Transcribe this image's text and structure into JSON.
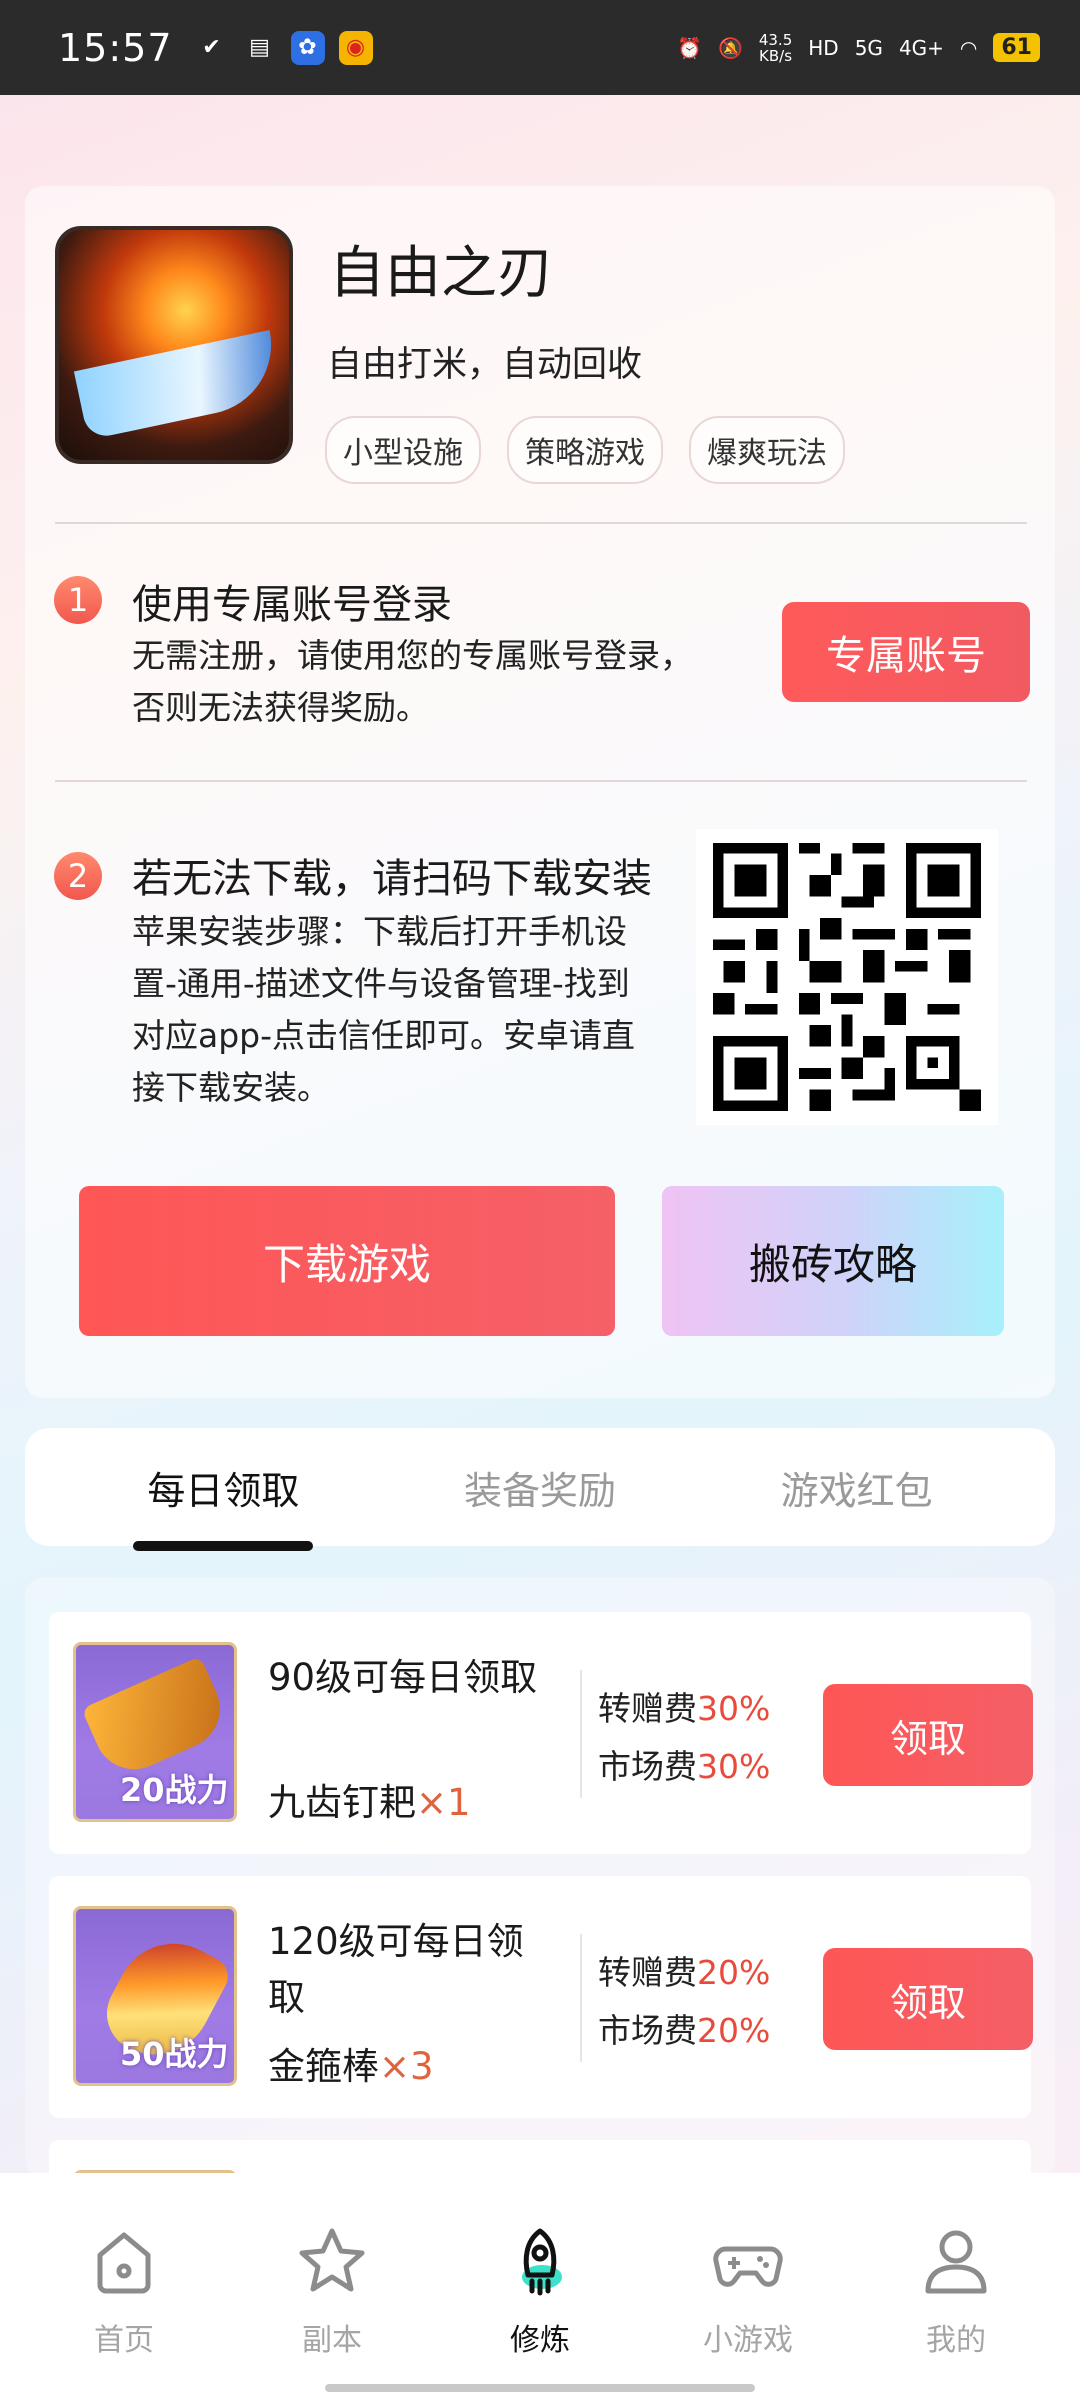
{
  "status_bar": {
    "time": "15:57",
    "speed": "43.5",
    "speed_unit": "KB/s",
    "network": "5G",
    "network2": "4G+",
    "battery": "61"
  },
  "game": {
    "title": "自由之刃",
    "subtitle": "自由打米，自动回收",
    "tags": [
      "小型设施",
      "策略游戏",
      "爆爽玩法"
    ]
  },
  "step1": {
    "num": "1",
    "title": "使用专属账号登录",
    "desc_line1": "无需注册，请使用您的专属账号登录，",
    "desc_line2": "否则无法获得奖励。",
    "button": "专属账号"
  },
  "step2": {
    "num": "2",
    "title": "若无法下载，请扫码下载安装",
    "desc_line1": "苹果安装步骤：下载后打开手机设",
    "desc_line2": "置-通用-描述文件与设备管理-找到",
    "desc_line3": "对应app-点击信任即可。安卓请直",
    "desc_line4": "接下载安装。"
  },
  "actions": {
    "download": "下载游戏",
    "guide": "搬砖攻略"
  },
  "tabs": [
    {
      "label": "每日领取",
      "active": true
    },
    {
      "label": "装备奖励",
      "active": false
    },
    {
      "label": "游戏红包",
      "active": false
    }
  ],
  "rewards": [
    {
      "title": "90级可每日领取",
      "item": "九齿钉耙",
      "qty": "×1",
      "power": "20战力",
      "transfer_label": "转赠费",
      "transfer_pct": "30%",
      "market_label": "市场费",
      "market_pct": "30%",
      "button": "领取"
    },
    {
      "title": "120级可每日领取",
      "item": "金箍棒",
      "qty": "×3",
      "power": "50战力",
      "transfer_label": "转赠费",
      "transfer_pct": "20%",
      "market_label": "市场费",
      "market_pct": "20%",
      "button": "领取"
    }
  ],
  "nav": [
    {
      "label": "首页",
      "icon": "home-icon",
      "active": false
    },
    {
      "label": "副本",
      "icon": "star-icon",
      "active": false
    },
    {
      "label": "修炼",
      "icon": "rocket-icon",
      "active": true
    },
    {
      "label": "小游戏",
      "icon": "gamepad-icon",
      "active": false
    },
    {
      "label": "我的",
      "icon": "profile-icon",
      "active": false
    }
  ],
  "colors": {
    "accent_red": "#f2574f",
    "active_nav_icon": "#3de0c8"
  }
}
